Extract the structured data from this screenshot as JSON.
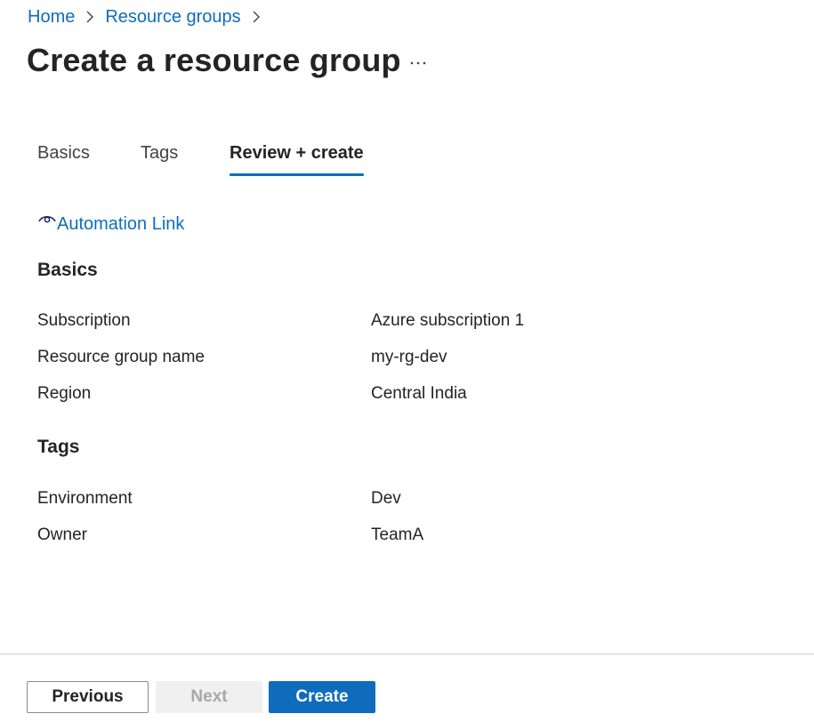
{
  "breadcrumb": {
    "items": [
      {
        "label": "Home"
      },
      {
        "label": "Resource groups"
      }
    ]
  },
  "page": {
    "title": "Create a resource group",
    "more_icon": "more-horizontal-icon"
  },
  "tabs": [
    {
      "label": "Basics",
      "active": false
    },
    {
      "label": "Tags",
      "active": false
    },
    {
      "label": "Review + create",
      "active": true
    }
  ],
  "automation": {
    "label": "Automation Link",
    "icon": "eye-icon"
  },
  "basics": {
    "heading": "Basics",
    "rows": [
      {
        "label": "Subscription",
        "value": "Azure subscription 1"
      },
      {
        "label": "Resource group name",
        "value": "my-rg-dev"
      },
      {
        "label": "Region",
        "value": "Central India"
      }
    ]
  },
  "tags": {
    "heading": "Tags",
    "rows": [
      {
        "label": "Environment",
        "value": "Dev"
      },
      {
        "label": "Owner",
        "value": "TeamA"
      }
    ]
  },
  "footer": {
    "previous_label": "Previous",
    "next_label": "Next",
    "create_label": "Create",
    "next_disabled": true
  },
  "colors": {
    "accent": "#0f6cbd",
    "text": "#242424",
    "divider": "#d1d1d1",
    "disabled_bg": "#f0f0f0",
    "disabled_text": "#a8a8a8"
  }
}
